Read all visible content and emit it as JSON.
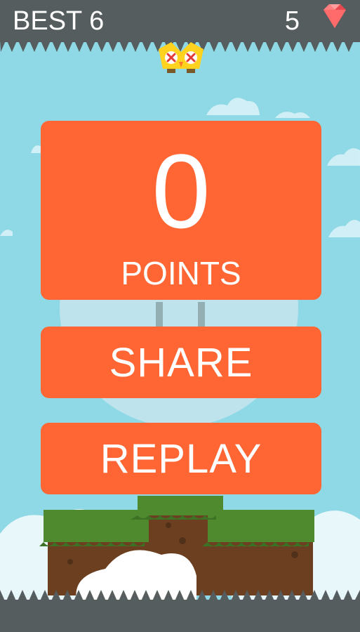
{
  "hud": {
    "best_text": "BEST 6",
    "gems": "5",
    "gem_icon": "red-gem-icon"
  },
  "results": {
    "score": "0",
    "points_label": "POINTS"
  },
  "buttons": {
    "share_label": "SHARE",
    "replay_label": "REPLAY"
  },
  "character": {
    "name_icon": "dead-yellow-bird-icon"
  },
  "colors": {
    "sky": "#8fd9e6",
    "panel": "#ff6633",
    "bar": "#565d5e",
    "grass": "#4f8a2e",
    "dirt": "#6b3f1f"
  }
}
